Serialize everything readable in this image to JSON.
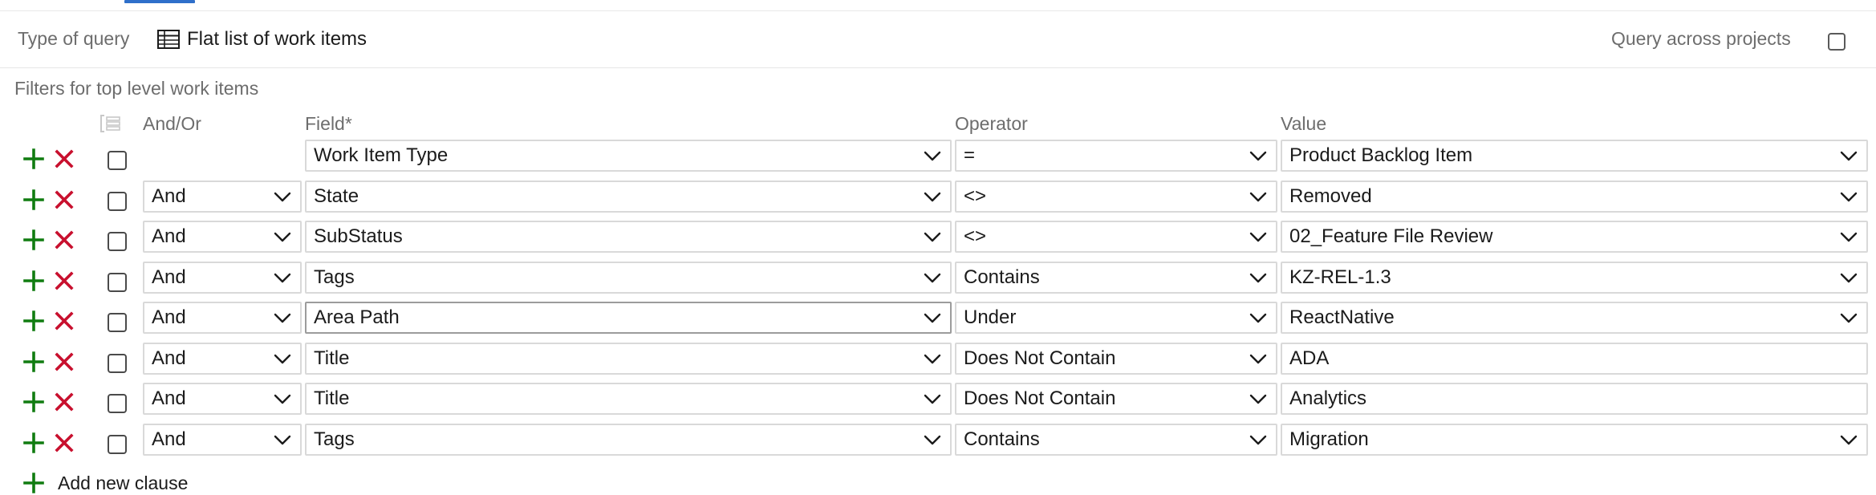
{
  "header": {
    "type_of_query_label": "Type of query",
    "type_of_query_value": "Flat list of work items",
    "query_across_projects_label": "Query across projects",
    "query_across_projects_checked": false
  },
  "filters": {
    "title": "Filters for top level work items",
    "columns": {
      "and_or": "And/Or",
      "field": "Field*",
      "operator": "Operator",
      "value": "Value"
    },
    "clauses": [
      {
        "and_or": "",
        "field": "Work Item Type",
        "operator": "=",
        "value": "Product Backlog Item",
        "value_dropdown": true
      },
      {
        "and_or": "And",
        "field": "State",
        "operator": "<>",
        "value": "Removed",
        "value_dropdown": true
      },
      {
        "and_or": "And",
        "field": "SubStatus",
        "operator": "<>",
        "value": "02_Feature File Review",
        "value_dropdown": true
      },
      {
        "and_or": "And",
        "field": "Tags",
        "operator": "Contains",
        "value": "KZ-REL-1.3",
        "value_dropdown": true
      },
      {
        "and_or": "And",
        "field": "Area Path",
        "operator": "Under",
        "value": "ReactNative",
        "value_dropdown": true
      },
      {
        "and_or": "And",
        "field": "Title",
        "operator": "Does Not Contain",
        "value": "ADA",
        "value_dropdown": false
      },
      {
        "and_or": "And",
        "field": "Title",
        "operator": "Does Not Contain",
        "value": "Analytics",
        "value_dropdown": false
      },
      {
        "and_or": "And",
        "field": "Tags",
        "operator": "Contains",
        "value": "Migration",
        "value_dropdown": true
      }
    ],
    "add_new_clause_label": "Add new clause"
  },
  "colors": {
    "accent": "#2f6fca",
    "add_green": "#107c10",
    "delete_red": "#c8102e"
  }
}
